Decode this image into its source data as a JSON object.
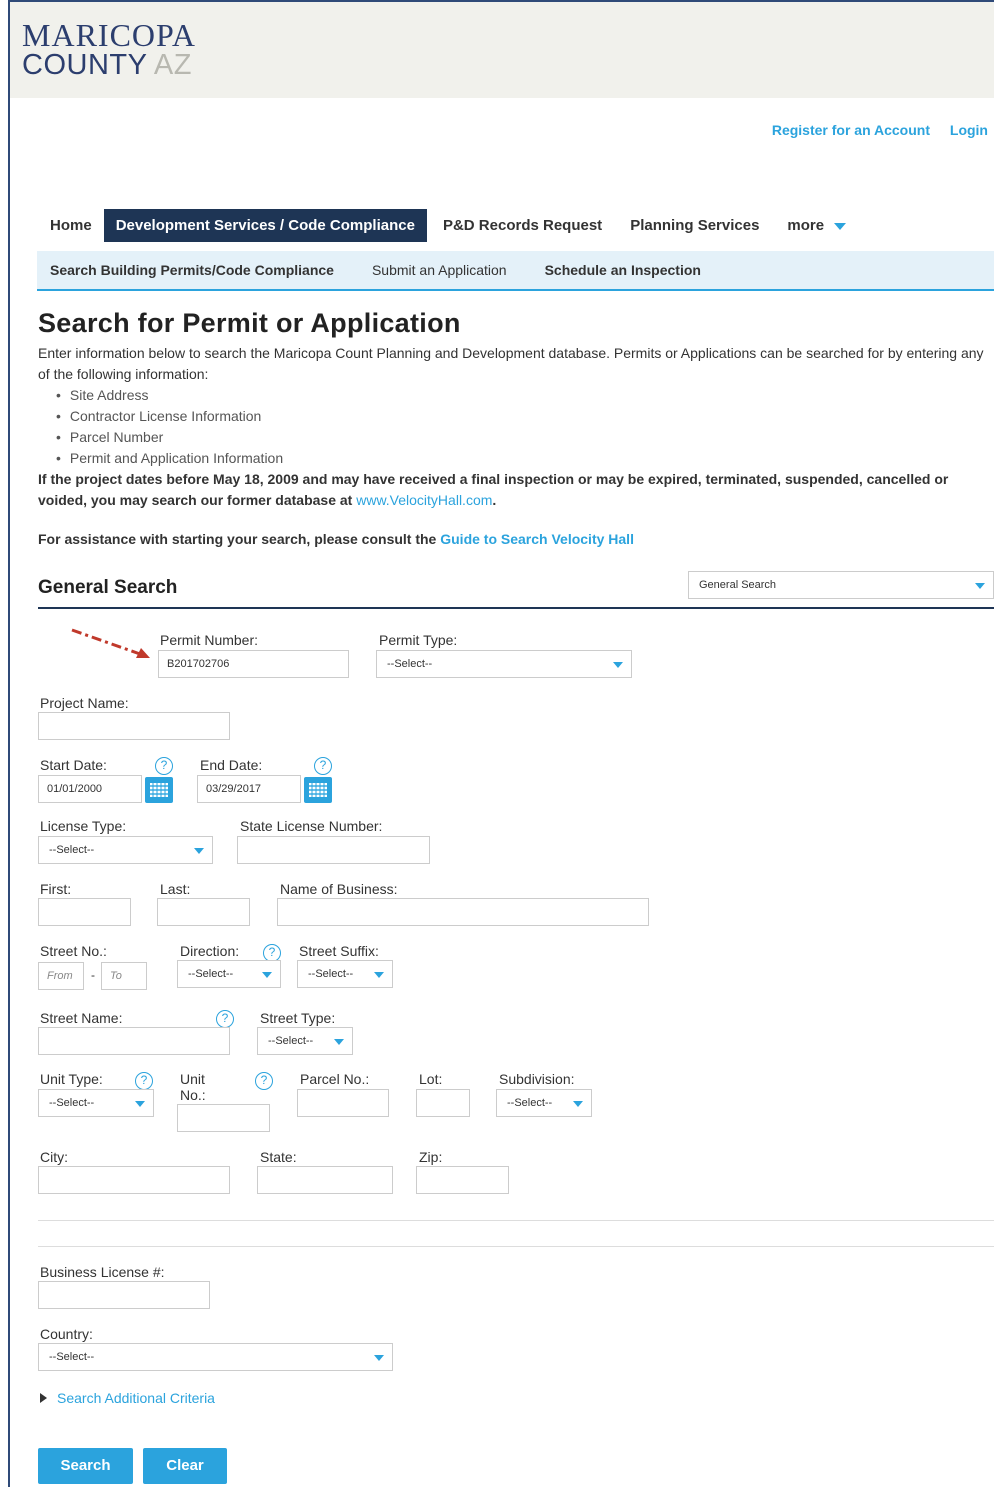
{
  "brand": {
    "line1": "MARICOPA",
    "line2": "COUNTY",
    "suffix": "AZ"
  },
  "account": {
    "register": "Register for an Account",
    "login": "Login"
  },
  "main_nav": {
    "home": "Home",
    "development": "Development Services / Code Compliance",
    "records": "P&D Records Request",
    "planning": "Planning Services",
    "more": "more"
  },
  "sub_nav": {
    "search": "Search Building Permits/Code Compliance",
    "submit": "Submit an Application",
    "schedule": "Schedule an Inspection"
  },
  "page": {
    "title": "Search for Permit or Application",
    "intro": "Enter information below to search the Maricopa Count Planning and Development database. Permits or Applications can be searched for by entering any of the following information:",
    "bullets": [
      "Site Address",
      "Contractor License Information",
      "Parcel Number",
      "Permit and Application Information"
    ],
    "notice": "If the project dates before May 18, 2009 and may have received a final inspection or may be expired, terminated, suspended, cancelled or voided, you may search our former database at",
    "notice_link": "www.VelocityHall.com",
    "notice_end": ".",
    "assist": "For assistance with starting your search, please consult the",
    "assist_link": "Guide to Search Velocity Hall"
  },
  "general_search": {
    "title": "General Search",
    "selector_value": "General Search"
  },
  "form": {
    "permit_number": {
      "label": "Permit Number:",
      "value": "B201702706"
    },
    "permit_type": {
      "label": "Permit Type:",
      "value": "--Select--"
    },
    "project_name": {
      "label": "Project Name:",
      "value": ""
    },
    "start_date": {
      "label": "Start Date:",
      "value": "01/01/2000"
    },
    "end_date": {
      "label": "End Date:",
      "value": "03/29/2017"
    },
    "license_type": {
      "label": "License Type:",
      "value": "--Select--"
    },
    "state_license": {
      "label": "State License Number:",
      "value": ""
    },
    "first": {
      "label": "First:",
      "value": ""
    },
    "last": {
      "label": "Last:",
      "value": ""
    },
    "business_name": {
      "label": "Name of Business:",
      "value": ""
    },
    "street_no": {
      "label": "Street No.:",
      "from_placeholder": "From",
      "to_placeholder": "To",
      "separator": "-"
    },
    "direction": {
      "label": "Direction:",
      "value": "--Select--"
    },
    "street_suffix": {
      "label": "Street Suffix:",
      "value": "--Select--"
    },
    "street_name": {
      "label": "Street Name:",
      "value": ""
    },
    "street_type": {
      "label": "Street Type:",
      "value": "--Select--"
    },
    "unit_type": {
      "label": "Unit Type:",
      "value": "--Select--"
    },
    "unit_no": {
      "label_1": "Unit",
      "label_2": "No.:",
      "value": ""
    },
    "parcel_no": {
      "label": "Parcel No.:",
      "value": ""
    },
    "lot": {
      "label": "Lot:",
      "value": ""
    },
    "subdivision": {
      "label": "Subdivision:",
      "value": "--Select--"
    },
    "city": {
      "label": "City:",
      "value": ""
    },
    "state": {
      "label": "State:",
      "value": ""
    },
    "zip": {
      "label": "Zip:",
      "value": ""
    },
    "business_license": {
      "label": "Business License #:",
      "value": ""
    },
    "country": {
      "label": "Country:",
      "value": "--Select--"
    },
    "help_glyph": "?"
  },
  "additional_criteria": "Search Additional Criteria",
  "buttons": {
    "search": "Search",
    "clear": "Clear"
  },
  "colors": {
    "accent": "#2ba3dd",
    "nav_dark": "#1e3555",
    "brand": "#2c3e6e",
    "annotation_arrow": "#c0392b"
  }
}
